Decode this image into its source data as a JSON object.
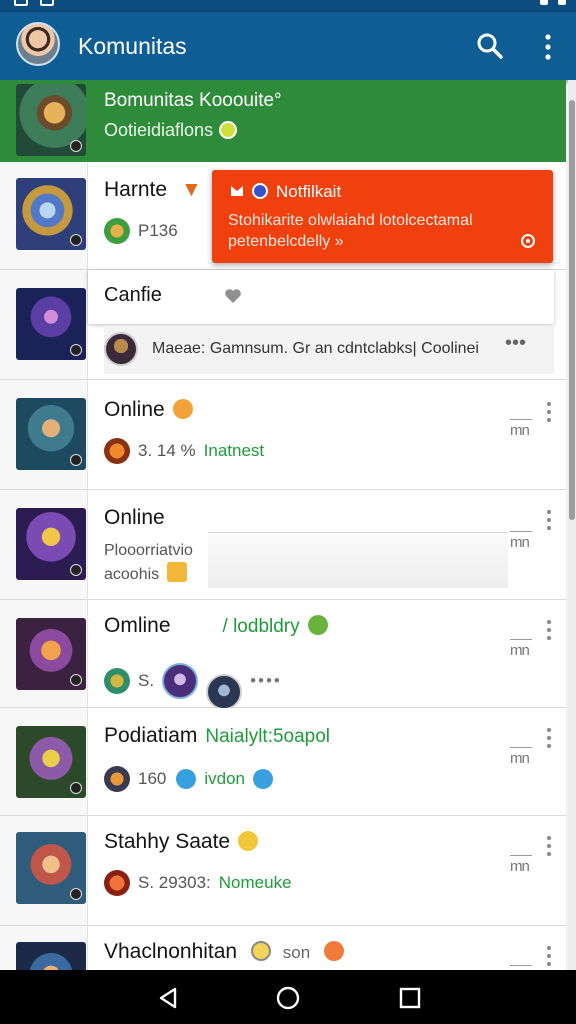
{
  "app": {
    "title": "Komunitas"
  },
  "banner": {
    "title": "Bomunitas Kooouite°",
    "subtitle": "Ootieidiaflons"
  },
  "notification": {
    "title": "Notfilkait",
    "body": "Stohikarite olwlaiahd lotolcectamal petenbelcdelly »"
  },
  "rows": [
    {
      "name": "Harnte",
      "meta": "P136",
      "time": ""
    },
    {
      "name": "Canfie",
      "meta": "",
      "time": ""
    },
    {
      "name": "Online",
      "meta": "3. 14 %",
      "meta_green": "Inatnest",
      "time": "mn"
    },
    {
      "name": "Online",
      "meta_line1": "Plooorriatvio",
      "meta_line2": "acoohis",
      "time": "mn"
    },
    {
      "name": "Omline",
      "name_tag": "/ lodbldry",
      "meta": "S.",
      "meta_dots": "••••",
      "time": "mn"
    },
    {
      "name": "Podiatiam",
      "name_tag": "Naialylt:5oapol",
      "meta": "160",
      "meta_green": "ivdon",
      "time": "mn"
    },
    {
      "name": "Stahhy Saate",
      "meta": "S. 29303:",
      "meta_green": "Nomeuke",
      "time": "mn"
    },
    {
      "name": "Vhaclnonhitan",
      "meta_extra": "son",
      "time": "mn"
    }
  ],
  "game_message": {
    "text": "Maeae: Gamnsum. Gr an cdntclabks| Coolinei",
    "dots": "•••"
  },
  "colors": {
    "appbar": "#0e5d95",
    "banner": "#2e8b3a",
    "notification": "#f0400e",
    "accent_green": "#1f9c3a"
  },
  "icons": [
    "search-icon",
    "more-vert-icon",
    "back-icon",
    "home-icon",
    "recent-apps-icon",
    "heart-icon",
    "bell-icon"
  ]
}
